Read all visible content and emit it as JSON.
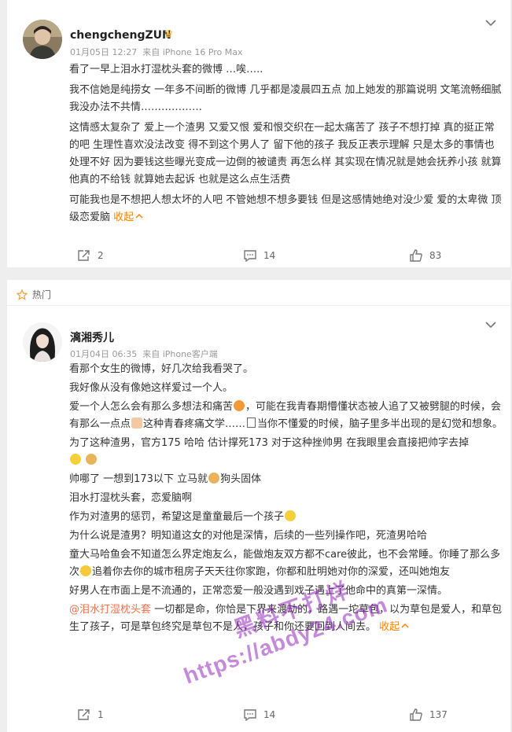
{
  "posts": [
    {
      "username": "chengchengZUN",
      "date": "01月05日 12:27",
      "source": "来自 iPhone 16 Pro Max",
      "paragraphs": [
        "看了一早上泪水打湿枕头套的微博 …唉…..",
        "我不信她是纯捞女 一年多不间断的微博 几乎都是凌晨四五点 加上她发的那篇说明 文笔流畅细腻 我没办法不共情………………",
        "这情感太复杂了 爱上一个渣男 又爱又恨 爱和恨交织在一起太痛苦了 孩子不想打掉 真的挺正常的吧 生理性喜欢没法改变 得不到这个男人了 留下他的孩子 我反正表示理解 只是太多的事情也处理不好 因为要钱这些曝光变成一边倒的被谴责 再怎么样 其实现在情况就是她会抚养小孩 就算他真的不给钱 就算她去起诉 也就是这么点生活费",
        "可能我也是不想把人想太坏的人吧 不管她想不想多要钱 但是这感情她绝对没少爱 爱的太卑微 顶级恋爱脑"
      ],
      "collapse_label": "收起",
      "shares": "2",
      "comments": "14",
      "likes": "83"
    },
    {
      "hot_label": "热门",
      "username": "漓湘秀儿",
      "date": "01月04日 06:35",
      "source": "来自 iPhone客户端",
      "lines": {
        "l1": "看那个女生的微博，好几次给我看哭了。",
        "l2": "我好像从没有像她这样爱过一个人。",
        "l3a": "爱一个人怎么会有那么多想法和痛苦",
        "l3b": "，可能在我青春期懵懂状态被人追了又被劈腿的时候，会有那么一点点",
        "l3c": "这种青春疼痛文学……",
        "l3d": "当你不懂爱的时候，脑子里多半出现的是幻觉和想象。",
        "l4": "为了这种渣男，官方175 哈哈 估计撑死173 对于这种挫帅男 在我眼里会直接把帅字去掉",
        "l5a": "帅哪了 一想到173以下 立马就",
        "l5b": "狗头固体",
        "l6": "泪水打湿枕头套，恋爱脑啊",
        "l7": "作为对渣男的惩罚，希望这是童童最后一个孩子",
        "l8": "为什么说是渣男？明知道这女的对他是深情，后续的一些列操作吧，死渣男哈哈",
        "l9a": "童大马哈鱼会不知道怎么界定炮友么，能做炮友双方都不care彼此，也不会常睡。你睡了那么多次",
        "l9b": "追着你去你的城市租房子天天往你家跑，你都和肚明她对你的深爱，还叫她炮友",
        "l10": "好男人在市面上是不流通的，正常恋爱一般没遇到戏子遇上了他命中的真第一深情。",
        "l11_link": "@泪水打湿枕头套",
        "l11": " 一切都是命，你恰是下界来渡劫的，路遇一坨草包，以为草包是爱人，和草包生了孩子，可是草包终究是草包不是人，孩子和你还要回到人间去。"
      },
      "collapse_label": "收起",
      "shares": "1",
      "comments": "14",
      "likes": "137"
    }
  ],
  "watermark": {
    "line1": "黑料不打烊",
    "line2": "https://abdy24.com"
  },
  "colors": {
    "accent_orange": "#ff8200",
    "link": "#eb7350",
    "watermark": "#9628be"
  }
}
